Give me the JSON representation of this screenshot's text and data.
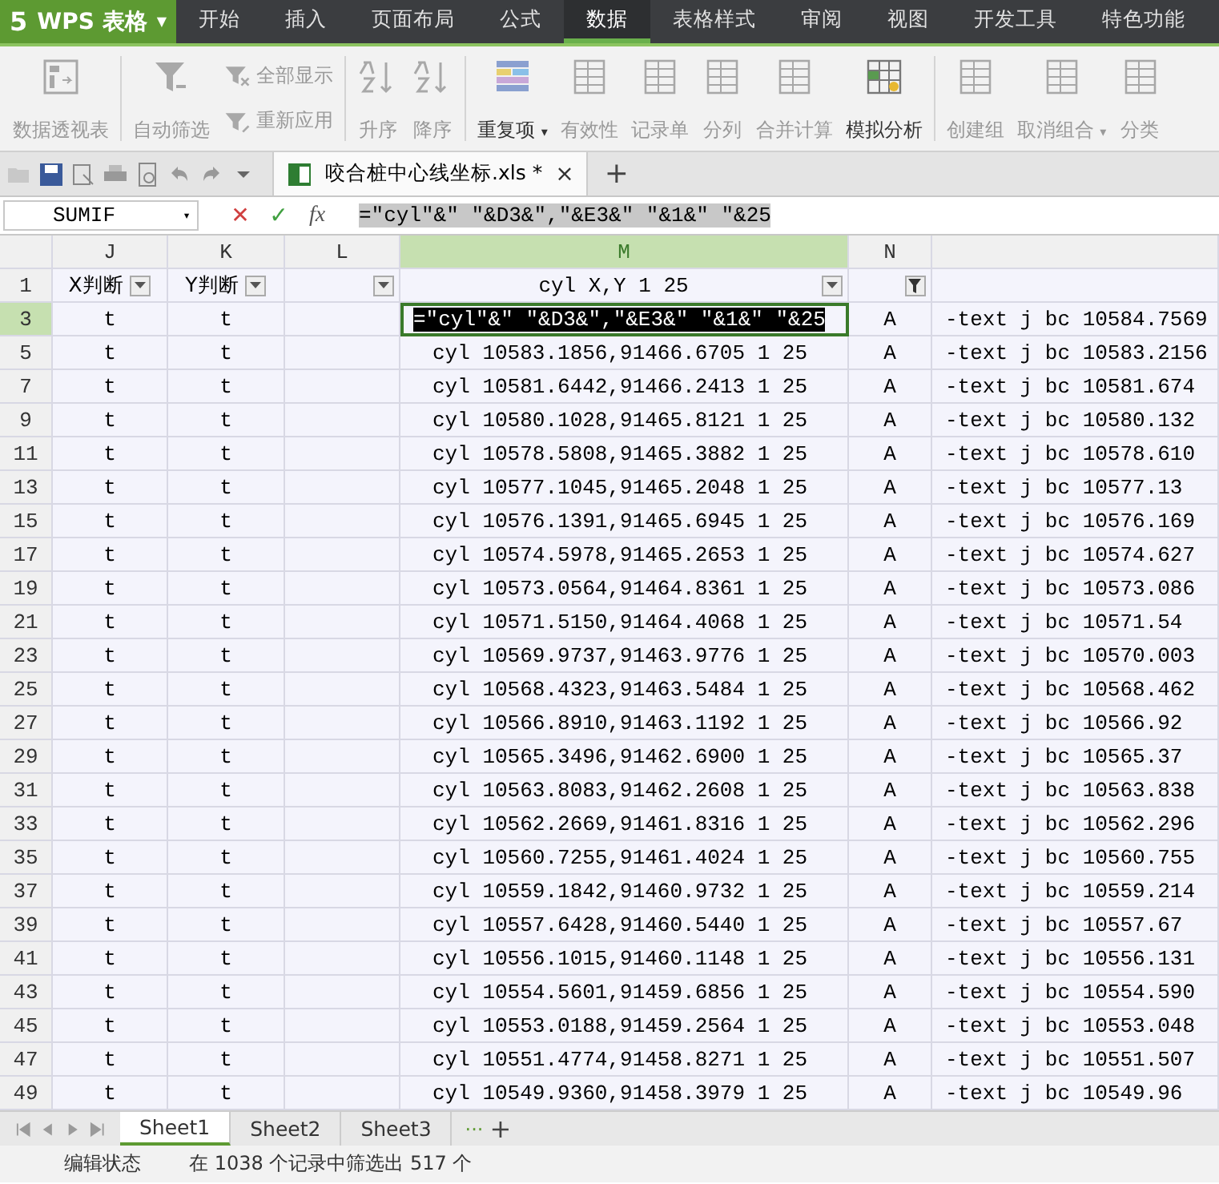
{
  "app": {
    "logo": "5",
    "name": "WPS 表格",
    "caret": "▼"
  },
  "menu_tabs": [
    {
      "label": "开始",
      "selected": false
    },
    {
      "label": "插入",
      "selected": false
    },
    {
      "label": "页面布局",
      "selected": false
    },
    {
      "label": "公式",
      "selected": false
    },
    {
      "label": "数据",
      "selected": true
    },
    {
      "label": "表格样式",
      "selected": false
    },
    {
      "label": "审阅",
      "selected": false
    },
    {
      "label": "视图",
      "selected": false
    },
    {
      "label": "开发工具",
      "selected": false
    },
    {
      "label": "特色功能",
      "selected": false
    }
  ],
  "ribbon": [
    {
      "kind": "big",
      "label": "数据透视表",
      "disabled": true
    },
    {
      "kind": "big",
      "label": "自动筛选",
      "disabled": true
    },
    {
      "kind": "pair",
      "items": [
        {
          "label": "全部显示",
          "disabled": true
        },
        {
          "label": "重新应用",
          "disabled": true
        }
      ]
    },
    {
      "kind": "big",
      "label": "升序",
      "disabled": true
    },
    {
      "kind": "big",
      "label": "降序",
      "disabled": true
    },
    {
      "kind": "big",
      "label": "重复项",
      "disabled": false,
      "caret": "▾"
    },
    {
      "kind": "big",
      "label": "有效性",
      "disabled": true
    },
    {
      "kind": "big",
      "label": "记录单",
      "disabled": true
    },
    {
      "kind": "big",
      "label": "分列",
      "disabled": true
    },
    {
      "kind": "big",
      "label": "合并计算",
      "disabled": true
    },
    {
      "kind": "big",
      "label": "模拟分析",
      "disabled": false
    },
    {
      "kind": "big",
      "label": "创建组",
      "disabled": true
    },
    {
      "kind": "big",
      "label": "取消组合",
      "disabled": true,
      "caret": "▾"
    },
    {
      "kind": "big",
      "label": "分类",
      "disabled": true
    }
  ],
  "doc_tab": {
    "title": "咬合桩中心线坐标.xls *",
    "close": "×",
    "new": "+"
  },
  "formula_bar": {
    "name_box": "SUMIF",
    "name_box_caret": "▾",
    "cancel": "✕",
    "enter": "✓",
    "fx": "fx",
    "formula": "=\"cyl\"&\" \"&D3&\",\"&E3&\" \"&1&\" \"&25"
  },
  "columns": [
    {
      "label": "J",
      "selected": false
    },
    {
      "label": "K",
      "selected": false
    },
    {
      "label": "L",
      "selected": false
    },
    {
      "label": "M",
      "selected": true
    },
    {
      "label": "N",
      "selected": false
    },
    {
      "selected": false
    }
  ],
  "header_row": {
    "number": "1",
    "cells": [
      {
        "text": "X判断",
        "kind": "dropdown"
      },
      {
        "text": "Y判断",
        "kind": "dropdown"
      },
      {
        "kind": "dropdown"
      },
      {
        "text": "cyl X,Y 1 25",
        "kind": "dropdown"
      },
      {
        "kind": "filtered"
      },
      {
        "kind": "plain"
      }
    ]
  },
  "rows": [
    {
      "number": "3",
      "selected": true,
      "j": "t",
      "k": "t",
      "m": "=\"cyl\"&\" \"&D3&\",\"&E3&\" \"&1&\" \"&25",
      "n": "A",
      "o": "-text j bc 10584.7569"
    },
    {
      "number": "5",
      "selected": false,
      "j": "t",
      "k": "t",
      "m": "cyl 10583.1856,91466.6705 1 25",
      "n": "A",
      "o": "-text j bc 10583.2156"
    },
    {
      "number": "7",
      "selected": false,
      "j": "t",
      "k": "t",
      "m": "cyl 10581.6442,91466.2413 1 25",
      "n": "A",
      "o": "-text j bc 10581.674"
    },
    {
      "number": "9",
      "selected": false,
      "j": "t",
      "k": "t",
      "m": "cyl 10580.1028,91465.8121 1 25",
      "n": "A",
      "o": "-text j bc 10580.132"
    },
    {
      "number": "11",
      "selected": false,
      "j": "t",
      "k": "t",
      "m": "cyl 10578.5808,91465.3882 1 25",
      "n": "A",
      "o": "-text j bc 10578.610"
    },
    {
      "number": "13",
      "selected": false,
      "j": "t",
      "k": "t",
      "m": "cyl 10577.1045,91465.2048 1 25",
      "n": "A",
      "o": "-text j bc 10577.13"
    },
    {
      "number": "15",
      "selected": false,
      "j": "t",
      "k": "t",
      "m": "cyl 10576.1391,91465.6945 1 25",
      "n": "A",
      "o": "-text j bc 10576.169"
    },
    {
      "number": "17",
      "selected": false,
      "j": "t",
      "k": "t",
      "m": "cyl 10574.5978,91465.2653 1 25",
      "n": "A",
      "o": "-text j bc 10574.627"
    },
    {
      "number": "19",
      "selected": false,
      "j": "t",
      "k": "t",
      "m": "cyl 10573.0564,91464.8361 1 25",
      "n": "A",
      "o": "-text j bc 10573.086"
    },
    {
      "number": "21",
      "selected": false,
      "j": "t",
      "k": "t",
      "m": "cyl 10571.5150,91464.4068 1 25",
      "n": "A",
      "o": "-text j bc 10571.54"
    },
    {
      "number": "23",
      "selected": false,
      "j": "t",
      "k": "t",
      "m": "cyl 10569.9737,91463.9776 1 25",
      "n": "A",
      "o": "-text j bc 10570.003"
    },
    {
      "number": "25",
      "selected": false,
      "j": "t",
      "k": "t",
      "m": "cyl 10568.4323,91463.5484 1 25",
      "n": "A",
      "o": "-text j bc 10568.462"
    },
    {
      "number": "27",
      "selected": false,
      "j": "t",
      "k": "t",
      "m": "cyl 10566.8910,91463.1192 1 25",
      "n": "A",
      "o": "-text j bc 10566.92"
    },
    {
      "number": "29",
      "selected": false,
      "j": "t",
      "k": "t",
      "m": "cyl 10565.3496,91462.6900 1 25",
      "n": "A",
      "o": "-text j bc 10565.37"
    },
    {
      "number": "31",
      "selected": false,
      "j": "t",
      "k": "t",
      "m": "cyl 10563.8083,91462.2608 1 25",
      "n": "A",
      "o": "-text j bc 10563.838"
    },
    {
      "number": "33",
      "selected": false,
      "j": "t",
      "k": "t",
      "m": "cyl 10562.2669,91461.8316 1 25",
      "n": "A",
      "o": "-text j bc 10562.296"
    },
    {
      "number": "35",
      "selected": false,
      "j": "t",
      "k": "t",
      "m": "cyl 10560.7255,91461.4024 1 25",
      "n": "A",
      "o": "-text j bc 10560.755"
    },
    {
      "number": "37",
      "selected": false,
      "j": "t",
      "k": "t",
      "m": "cyl 10559.1842,91460.9732 1 25",
      "n": "A",
      "o": "-text j bc 10559.214"
    },
    {
      "number": "39",
      "selected": false,
      "j": "t",
      "k": "t",
      "m": "cyl 10557.6428,91460.5440 1 25",
      "n": "A",
      "o": "-text j bc 10557.67"
    },
    {
      "number": "41",
      "selected": false,
      "j": "t",
      "k": "t",
      "m": "cyl 10556.1015,91460.1148 1 25",
      "n": "A",
      "o": "-text j bc 10556.131"
    },
    {
      "number": "43",
      "selected": false,
      "j": "t",
      "k": "t",
      "m": "cyl 10554.5601,91459.6856 1 25",
      "n": "A",
      "o": "-text j bc 10554.590"
    },
    {
      "number": "45",
      "selected": false,
      "j": "t",
      "k": "t",
      "m": "cyl 10553.0188,91459.2564 1 25",
      "n": "A",
      "o": "-text j bc 10553.048"
    },
    {
      "number": "47",
      "selected": false,
      "j": "t",
      "k": "t",
      "m": "cyl 10551.4774,91458.8271 1 25",
      "n": "A",
      "o": "-text j bc 10551.507"
    },
    {
      "number": "49",
      "selected": false,
      "j": "t",
      "k": "t",
      "m": "cyl 10549.9360,91458.3979 1 25",
      "n": "A",
      "o": "-text j bc 10549.96"
    }
  ],
  "sheet_tabs": [
    {
      "label": "Sheet1",
      "selected": true
    },
    {
      "label": "Sheet2",
      "selected": false
    },
    {
      "label": "Sheet3",
      "selected": false
    }
  ],
  "sheet_more": "···",
  "sheet_add": "+",
  "status_bar": {
    "mode": "编辑状态",
    "filter_info": "在 1038 个记录中筛选出 517 个"
  }
}
